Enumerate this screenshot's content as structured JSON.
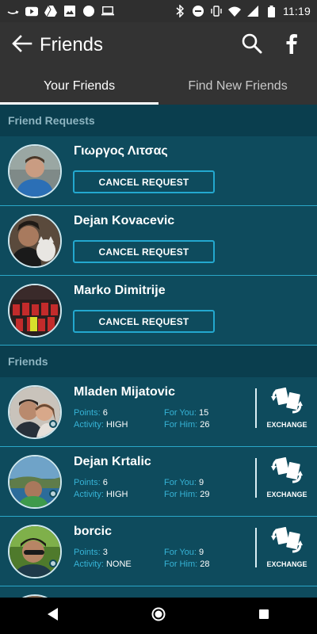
{
  "status_bar": {
    "time": "11:19",
    "left_icons": [
      "amazon-icon",
      "youtube-icon",
      "drive-icon",
      "photos-icon",
      "circle-icon",
      "laptop-icon"
    ],
    "right_icons": [
      "bluetooth-icon",
      "do-not-disturb-icon",
      "vibrate-icon",
      "wifi-icon",
      "signal-icon",
      "battery-icon"
    ]
  },
  "app_bar": {
    "title": "Friends",
    "back_icon": "arrow-left-icon",
    "actions": [
      "search-icon",
      "facebook-icon"
    ]
  },
  "tabs": [
    {
      "label": "Your Friends",
      "active": true
    },
    {
      "label": "Find New Friends",
      "active": false
    }
  ],
  "sections": {
    "requests_header": "Friend Requests",
    "friends_header": "Friends"
  },
  "requests": [
    {
      "name": "Γιωργος Λιτσας",
      "button": "CANCEL REQUEST"
    },
    {
      "name": "Dejan Kovacevic",
      "button": "CANCEL REQUEST"
    },
    {
      "name": "Marko Dimitrije",
      "button": "CANCEL REQUEST"
    }
  ],
  "stat_labels": {
    "points": "Points:",
    "activity": "Activity:",
    "for_you": "For You:",
    "for_him": "For Him:"
  },
  "friends": [
    {
      "name": "Mladen Mijatovic",
      "points": "6",
      "activity": "HIGH",
      "for_you": "15",
      "for_him": "26",
      "exchange": "EXCHANGE"
    },
    {
      "name": "Dejan Krtalic",
      "points": "6",
      "activity": "HIGH",
      "for_you": "9",
      "for_him": "29",
      "exchange": "EXCHANGE"
    },
    {
      "name": "borcic",
      "points": "3",
      "activity": "NONE",
      "for_you": "9",
      "for_him": "28",
      "exchange": "EXCHANGE"
    }
  ],
  "colors": {
    "background": "#0d4a5c",
    "section_header": "#0a3e4e",
    "accent": "#23a8cf",
    "app_bar": "#333333"
  }
}
